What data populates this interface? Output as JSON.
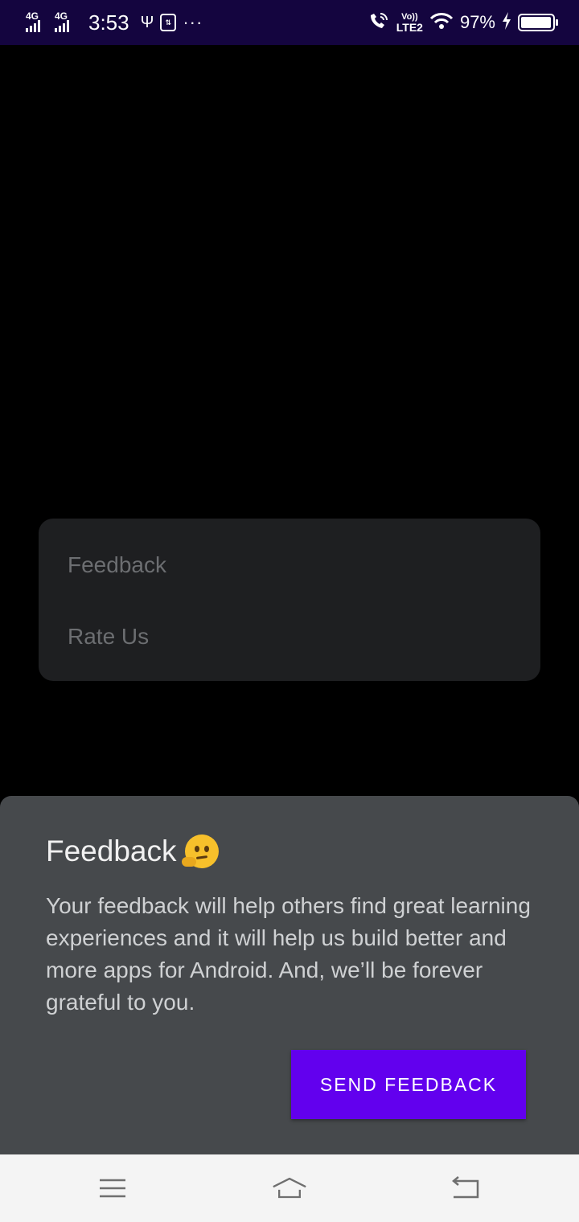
{
  "status_bar": {
    "network1": "4G",
    "network2": "4G",
    "time": "3:53",
    "more": "···",
    "volte_top": "Vo))",
    "volte_bottom": "LTE2",
    "battery_percent": "97%",
    "battery_level": 0.97,
    "background": "#14053f"
  },
  "menu": {
    "items": [
      {
        "label": "Feedback"
      },
      {
        "label": "Rate Us"
      }
    ]
  },
  "sheet": {
    "title": "Feedback",
    "emoji_icon": "thinking-face-icon",
    "body": "Your feedback will help others find great learning experiences and it will help us build better and more apps for Android. And, we’ll be forever grateful to you.",
    "button_label": "SEND FEEDBACK",
    "accent_color": "#6200ee",
    "background": "#46494c"
  },
  "nav_bar": {
    "icons": [
      "menu-icon",
      "home-icon",
      "back-icon"
    ]
  }
}
